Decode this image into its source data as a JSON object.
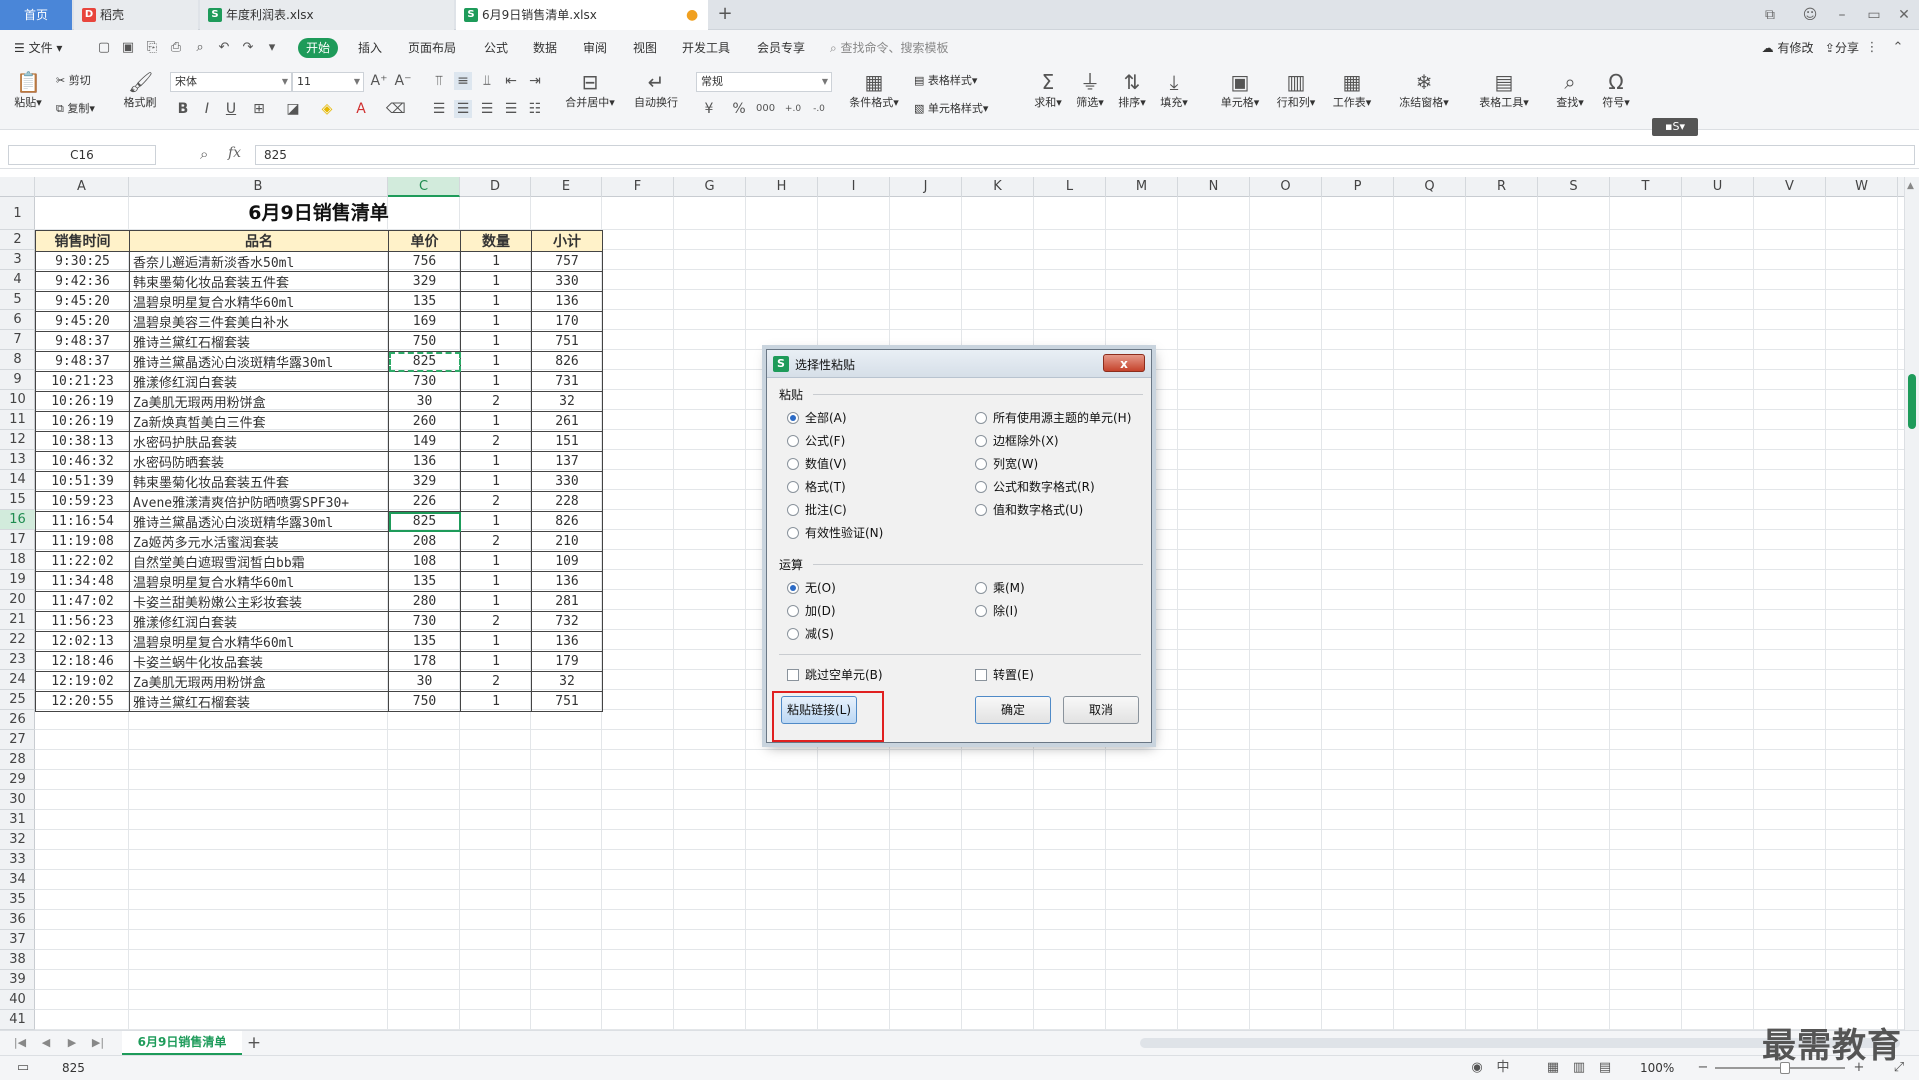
{
  "tabs": {
    "home": "首页",
    "docer": "稻壳",
    "profit": "年度利润表.xlsx",
    "sales": "6月9日销售清单.xlsx"
  },
  "menu": {
    "file": "文件",
    "start": "开始",
    "items": [
      "插入",
      "页面布局",
      "公式",
      "数据",
      "审阅",
      "视图",
      "开发工具",
      "会员专享"
    ],
    "search": "查找命令、搜索模板",
    "share": "分享",
    "changes": "有修改"
  },
  "ribbon": {
    "paste": "粘贴",
    "cut": "剪切",
    "copy": "复制",
    "format_painter": "格式刷",
    "font_name": "宋体",
    "font_size": "11",
    "merge_center": "合并居中",
    "wrap_text": "自动换行",
    "number_format": "常规",
    "cond_format": "条件格式",
    "table_style": "表格样式",
    "cell_style": "单元格样式",
    "sum": "求和",
    "filter": "筛选",
    "sort": "排序",
    "fill": "填充",
    "cell": "单元格",
    "row_col": "行和列",
    "worksheet": "工作表",
    "freeze": "冻结窗格",
    "table_tools": "表格工具",
    "find": "查找",
    "symbol": "符号",
    "currency": "¥",
    "percent": "%",
    "thousands": "000"
  },
  "formula_bar": {
    "name_box": "C16",
    "fx": "fx",
    "value": "825"
  },
  "columns": [
    "A",
    "B",
    "C",
    "D",
    "E",
    "F",
    "G",
    "H",
    "I",
    "J",
    "K",
    "L",
    "M",
    "N",
    "O",
    "P",
    "Q",
    "R",
    "S",
    "T",
    "U",
    "V",
    "W"
  ],
  "sheet": {
    "title": "6月9日销售清单",
    "headers": [
      "销售时间",
      "品名",
      "单价",
      "数量",
      "小计"
    ],
    "rows": [
      [
        "9:30:25",
        "香奈儿邂逅清新淡香水50ml",
        "756",
        "1",
        "757"
      ],
      [
        "9:42:36",
        "韩束墨菊化妆品套装五件套",
        "329",
        "1",
        "330"
      ],
      [
        "9:45:20",
        "温碧泉明星复合水精华60ml",
        "135",
        "1",
        "136"
      ],
      [
        "9:45:20",
        "温碧泉美容三件套美白补水",
        "169",
        "1",
        "170"
      ],
      [
        "9:48:37",
        "雅诗兰黛红石榴套装",
        "750",
        "1",
        "751"
      ],
      [
        "9:48:37",
        "雅诗兰黛晶透沁白淡斑精华露30ml",
        "825",
        "1",
        "826"
      ],
      [
        "10:21:23",
        "雅漾修红润白套装",
        "730",
        "1",
        "731"
      ],
      [
        "10:26:19",
        "Za美肌无瑕两用粉饼盒",
        "30",
        "2",
        "32"
      ],
      [
        "10:26:19",
        "Za新焕真皙美白三件套",
        "260",
        "1",
        "261"
      ],
      [
        "10:38:13",
        "水密码护肤品套装",
        "149",
        "2",
        "151"
      ],
      [
        "10:46:32",
        "水密码防晒套装",
        "136",
        "1",
        "137"
      ],
      [
        "10:51:39",
        "韩束墨菊化妆品套装五件套",
        "329",
        "1",
        "330"
      ],
      [
        "10:59:23",
        "Avene雅漾清爽倍护防晒喷雾SPF30+",
        "226",
        "2",
        "228"
      ],
      [
        "11:16:54",
        "雅诗兰黛晶透沁白淡斑精华露30ml",
        "825",
        "1",
        "826"
      ],
      [
        "11:19:08",
        "Za姬芮多元水活蜜润套装",
        "208",
        "2",
        "210"
      ],
      [
        "11:22:02",
        "自然堂美白遮瑕雪润皙白bb霜",
        "108",
        "1",
        "109"
      ],
      [
        "11:34:48",
        "温碧泉明星复合水精华60ml",
        "135",
        "1",
        "136"
      ],
      [
        "11:47:02",
        "卡姿兰甜美粉嫩公主彩妆套装",
        "280",
        "1",
        "281"
      ],
      [
        "11:56:23",
        "雅漾修红润白套装",
        "730",
        "2",
        "732"
      ],
      [
        "12:02:13",
        "温碧泉明星复合水精华60ml",
        "135",
        "1",
        "136"
      ],
      [
        "12:18:46",
        "卡姿兰蜗牛化妆品套装",
        "178",
        "1",
        "179"
      ],
      [
        "12:19:02",
        "Za美肌无瑕两用粉饼盒",
        "30",
        "2",
        "32"
      ],
      [
        "12:20:55",
        "雅诗兰黛红石榴套装",
        "750",
        "1",
        "751"
      ]
    ]
  },
  "dialog": {
    "title": "选择性粘贴",
    "close": "x",
    "paste_section": "粘贴",
    "paste_options_left": [
      "全部(A)",
      "公式(F)",
      "数值(V)",
      "格式(T)",
      "批注(C)",
      "有效性验证(N)"
    ],
    "paste_options_right": [
      "所有使用源主题的单元(H)",
      "边框除外(X)",
      "列宽(W)",
      "公式和数字格式(R)",
      "值和数字格式(U)"
    ],
    "operation_section": "运算",
    "operation_left": [
      "无(O)",
      "加(D)",
      "减(S)"
    ],
    "operation_right": [
      "乘(M)",
      "除(I)"
    ],
    "skip_blanks": "跳过空单元(B)",
    "transpose": "转置(E)",
    "paste_link": "粘贴链接(L)",
    "ok": "确定",
    "cancel": "取消"
  },
  "sheet_tab": "6月9日销售清单",
  "status": {
    "value": "825",
    "zoom": "100%"
  },
  "watermark": "最需教育",
  "colors": {
    "accent": "#1e9b5a",
    "header_fill": "#fff2c9",
    "highlight": "#e02020"
  }
}
